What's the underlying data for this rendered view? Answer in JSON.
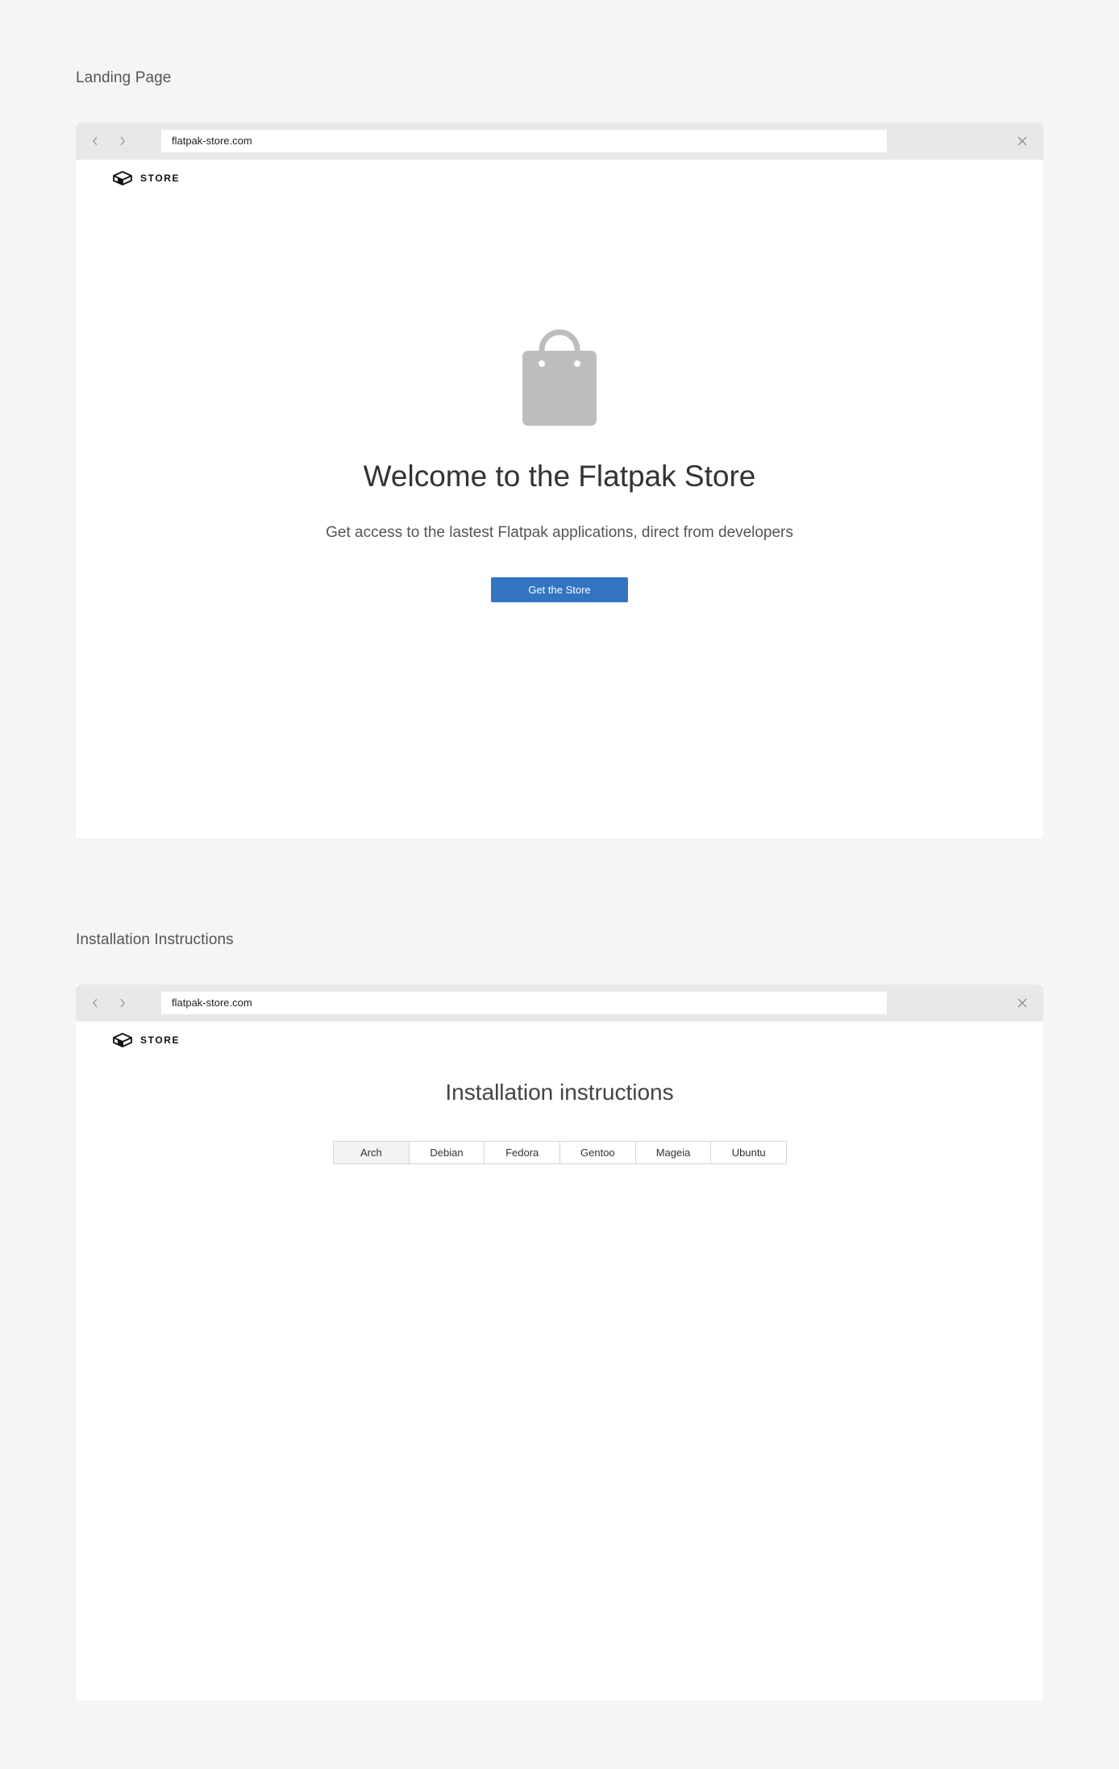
{
  "sections": [
    {
      "label": "Landing Page",
      "browser": {
        "url": "flatpak-store.com",
        "logo_text": "STORE"
      },
      "content": {
        "icon": "shopping-bag-icon",
        "title": "Welcome to the Flatpak Store",
        "subtitle": "Get access to the lastest Flatpak applications, direct from developers",
        "button_label": "Get the Store"
      }
    },
    {
      "label": "Installation Instructions",
      "browser": {
        "url": "flatpak-store.com",
        "logo_text": "STORE"
      },
      "content": {
        "title": "Installation instructions",
        "tabs": [
          "Arch",
          "Debian",
          "Fedora",
          "Gentoo",
          "Mageia",
          "Ubuntu"
        ],
        "active_tab": "Arch"
      }
    }
  ],
  "colors": {
    "page_background": "#f5f5f5",
    "browser_chrome": "#e8e8e8",
    "primary_button": "#3374c2",
    "bag_icon": "#bdbdbd"
  }
}
